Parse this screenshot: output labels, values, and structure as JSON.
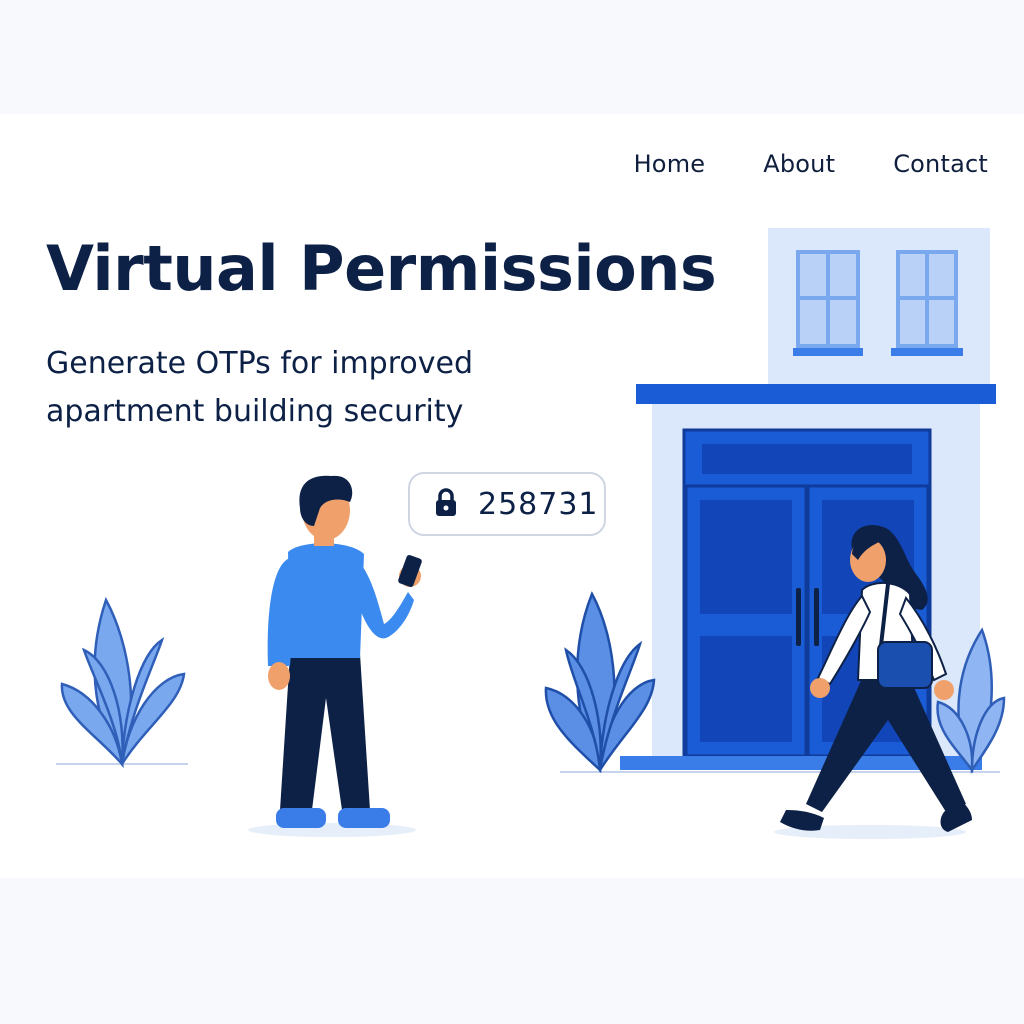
{
  "nav": {
    "items": [
      {
        "label": "Home"
      },
      {
        "label": "About"
      },
      {
        "label": "Contact"
      }
    ]
  },
  "hero": {
    "title": "Virtual Permissions",
    "subtitle": "Generate OTPs for improved apartment building security"
  },
  "otp": {
    "code": "258731",
    "icon": "lock-icon"
  },
  "colors": {
    "navy": "#0d2147",
    "brand_blue": "#1a5bd6",
    "light_blue": "#dbe7fb",
    "shirt_blue": "#3b8af0",
    "leaf_blue": "#7aa8ee"
  }
}
